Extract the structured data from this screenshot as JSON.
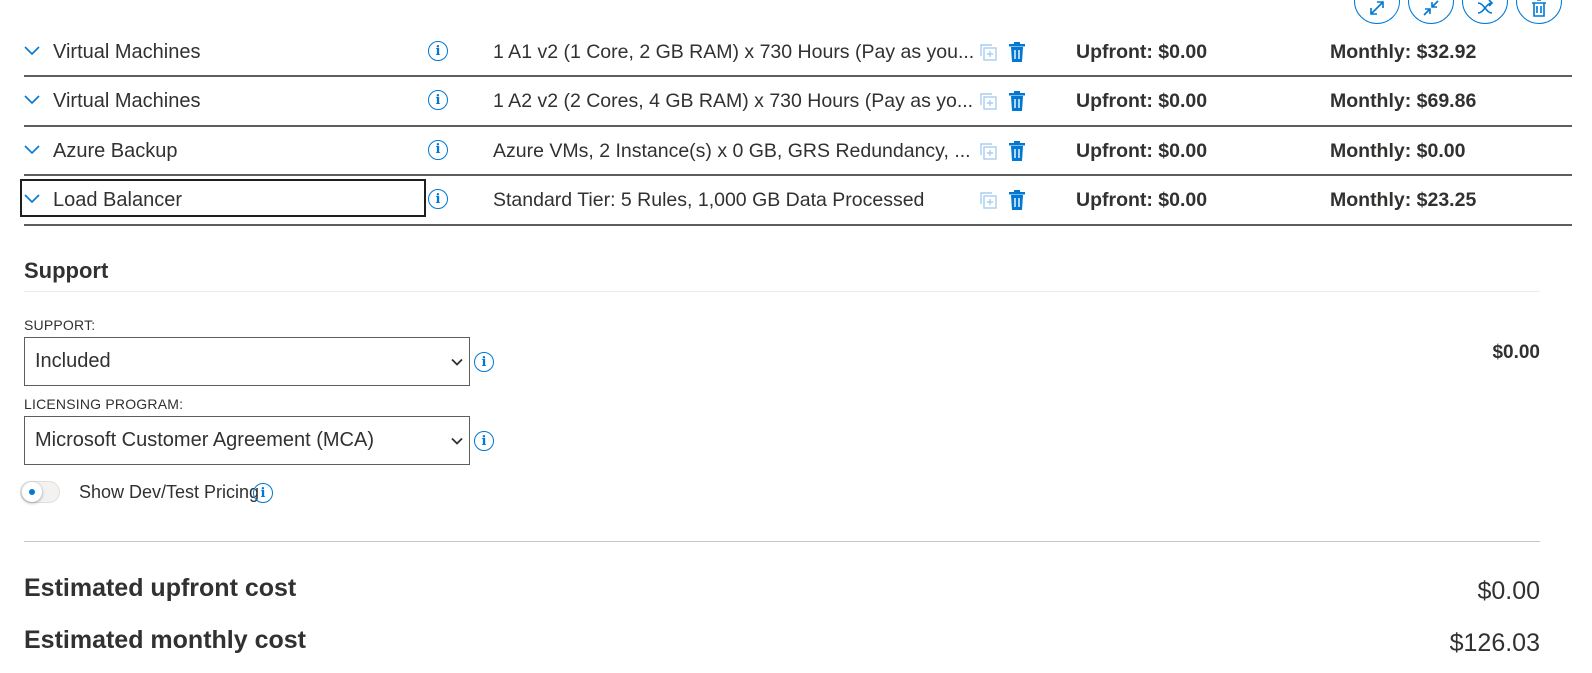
{
  "top_actions": [
    "expand-all-icon",
    "collapse-all-icon",
    "shuffle-icon",
    "delete-all-icon"
  ],
  "rows": [
    {
      "name": "Virtual Machines",
      "description": "1 A1 v2 (1 Core, 2 GB RAM) x 730 Hours (Pay as you...",
      "upfront": "Upfront: $0.00",
      "monthly": "Monthly: $32.92"
    },
    {
      "name": "Virtual Machines",
      "description": "1 A2 v2 (2 Cores, 4 GB RAM) x 730 Hours (Pay as yo...",
      "upfront": "Upfront: $0.00",
      "monthly": "Monthly: $69.86"
    },
    {
      "name": "Azure Backup",
      "description": "Azure VMs, 2 Instance(s) x 0 GB, GRS Redundancy, ...",
      "upfront": "Upfront: $0.00",
      "monthly": "Monthly: $0.00"
    },
    {
      "name": "Load Balancer",
      "description": "Standard Tier: 5 Rules, 1,000 GB Data Processed",
      "upfront": "Upfront: $0.00",
      "monthly": "Monthly: $23.25"
    }
  ],
  "support": {
    "title": "Support",
    "support_label": "SUPPORT:",
    "support_value": "Included",
    "support_price": "$0.00",
    "licensing_label": "LICENSING PROGRAM:",
    "licensing_value": "Microsoft Customer Agreement (MCA)",
    "devtest_label": "Show Dev/Test Pricing",
    "devtest_on": false
  },
  "totals": {
    "upfront_label": "Estimated upfront cost",
    "upfront_value": "$0.00",
    "monthly_label": "Estimated monthly cost",
    "monthly_value": "$126.03"
  },
  "colors": {
    "accent": "#0078d4",
    "text": "#323130",
    "row_border": "#605e5c"
  }
}
